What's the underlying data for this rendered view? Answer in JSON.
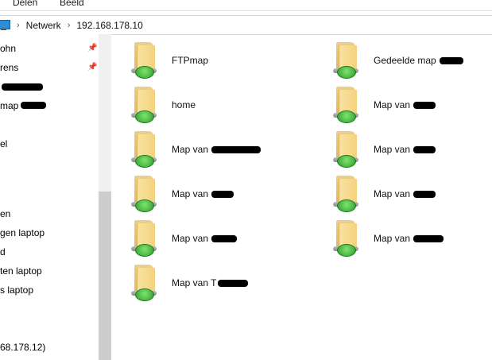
{
  "ribbon": {
    "tabs": [
      "Delen",
      "Beeld"
    ]
  },
  "address": {
    "icon": "computer-icon",
    "crumbs": [
      "Netwerk",
      "192.168.178.10"
    ]
  },
  "nav": {
    "items": [
      "ohn",
      "rens",
      "",
      "map",
      "el",
      "en",
      "gen laptop",
      "d",
      "ten laptop",
      "s laptop",
      "68.178.12)"
    ]
  },
  "folders": {
    "items": [
      {
        "label": "FTPmap"
      },
      {
        "label": "Gedeelde map"
      },
      {
        "label": "home"
      },
      {
        "label": "Map van"
      },
      {
        "label": "Map van"
      },
      {
        "label": "Map van"
      },
      {
        "label": "Map van"
      },
      {
        "label": "Map van"
      },
      {
        "label": "Map van"
      },
      {
        "label": "Map van"
      },
      {
        "label": "Map van T"
      }
    ]
  },
  "colors": {
    "scroll_track": "#f0f0f0",
    "scroll_thumb": "#cdcdcd",
    "border": "#d9d9d9"
  }
}
